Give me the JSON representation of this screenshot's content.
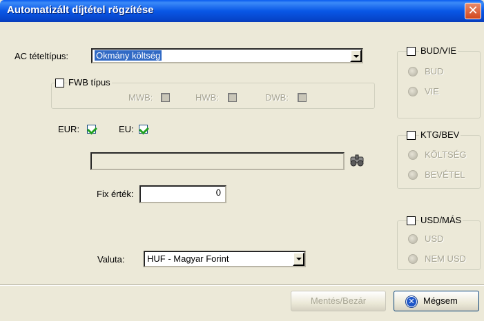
{
  "window": {
    "title": "Automatizált díjtétel rögzítése",
    "close_symbol": "✕"
  },
  "ac_type": {
    "label": "AC tételtípus:",
    "value": "Okmány költség"
  },
  "fwb": {
    "label": "FWB típus",
    "mwb": "MWB:",
    "hwb": "HWB:",
    "dwb": "DWB:"
  },
  "flags": {
    "eur": "EUR:",
    "eu": "EU:"
  },
  "fix": {
    "label": "Fix érték:",
    "value": "0"
  },
  "valuta": {
    "label": "Valuta:",
    "value": "HUF - Magyar Forint"
  },
  "groups": {
    "bud_vie": {
      "title": "BUD/VIE",
      "opt1": "BUD",
      "opt2": "VIE"
    },
    "ktg_bev": {
      "title": "KTG/BEV",
      "opt1": "KÖLTSÉG",
      "opt2": "BEVÉTEL"
    },
    "usd_mas": {
      "title": "USD/MÁS",
      "opt1": "USD",
      "opt2": "NEM USD"
    }
  },
  "buttons": {
    "save": "Mentés/Bezár",
    "cancel": "Mégsem"
  },
  "colors": {
    "titlebar": "#0957e6",
    "window_bg": "#ece9d8",
    "highlight": "#316ac5"
  }
}
